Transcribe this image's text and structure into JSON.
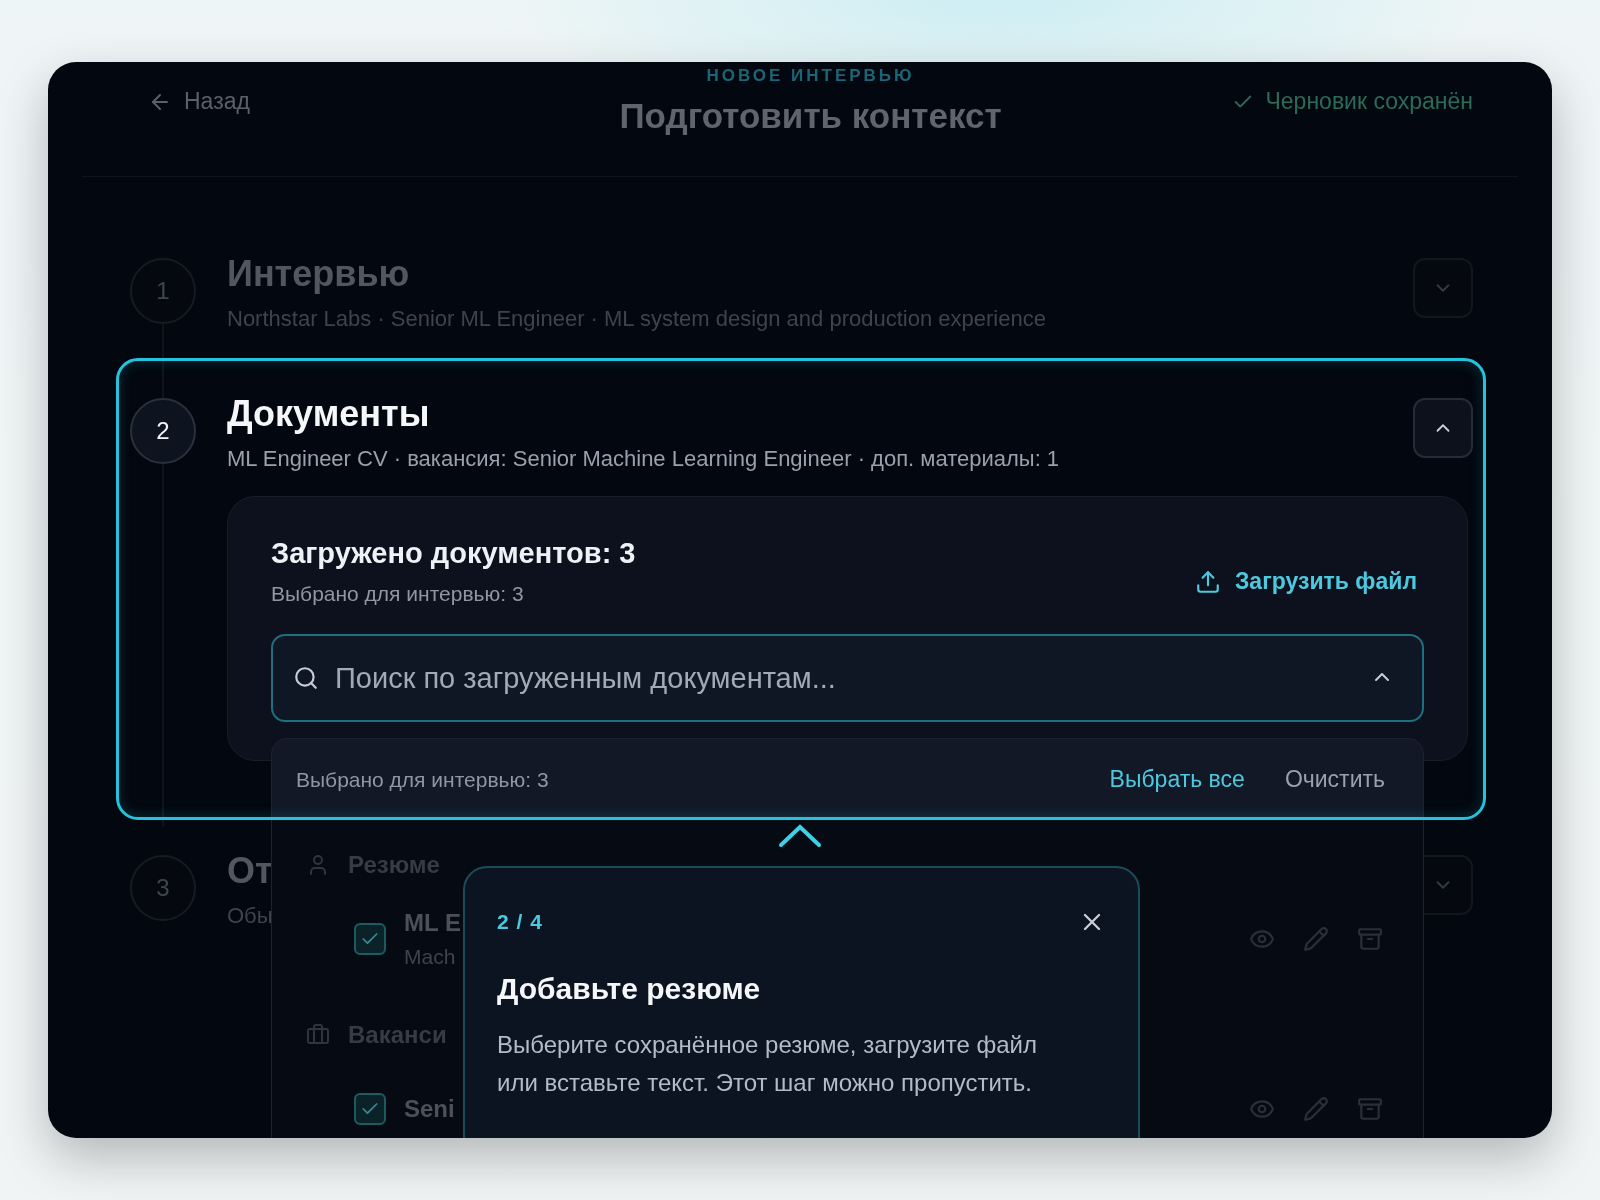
{
  "header": {
    "eyebrow": "НОВОЕ ИНТЕРВЬЮ",
    "back": "Назад",
    "title": "Подготовить контекст",
    "status": "Черновик сохранён"
  },
  "steps": [
    {
      "number": "1",
      "title": "Интервью",
      "subtitle": "Northstar Labs · Senior ML Engineer · ML system design and production experience",
      "expanded": false,
      "highlighted": false
    },
    {
      "number": "2",
      "title": "Документы",
      "subtitle": "ML Engineer CV · вакансия: Senior Machine Learning Engineer · доп. материалы: 1",
      "expanded": true,
      "highlighted": true
    },
    {
      "number": "3",
      "title": "От",
      "subtitle": "Обы",
      "expanded": false,
      "highlighted": false
    }
  ],
  "documents": {
    "heading": "Загружено документов: 3",
    "note": "Выбрано для интервью: 3",
    "upload": "Загрузить файл",
    "search": {
      "placeholder": "Поиск по загруженным документам...",
      "expanded": true
    }
  },
  "dropdown": {
    "summary": "Выбрано для интервью: 3",
    "select_all": "Выбрать все",
    "clear": "Очистить",
    "groups": [
      {
        "kind": "resume",
        "label": "Резюме",
        "items": [
          {
            "title": "ML E",
            "subtitle": "Mach",
            "checked": true
          }
        ]
      },
      {
        "kind": "vacancy",
        "label": "Ваканси",
        "items": [
          {
            "title": "Seni",
            "checked": true
          }
        ]
      }
    ]
  },
  "tour": {
    "step": "2 / 4",
    "title": "Добавьте резюме",
    "body": "Выберите сохранённое резюме, загрузите файл или вставьте текст. Этот шаг можно пропустить."
  }
}
